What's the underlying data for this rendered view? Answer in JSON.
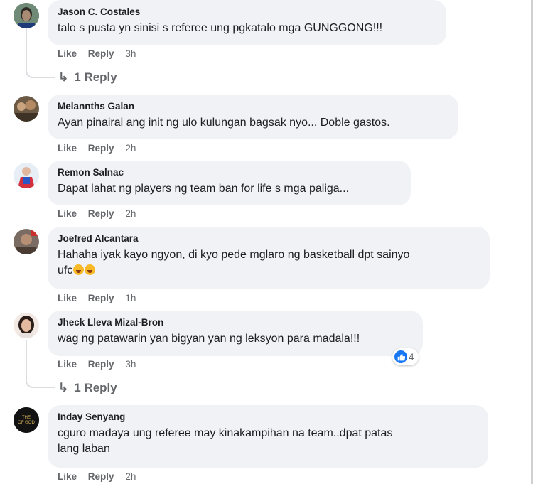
{
  "actions": {
    "like": "Like",
    "reply": "Reply"
  },
  "comments": [
    {
      "author": "Jason C. Costales",
      "text": "talo s pusta yn sinisi s referee ung pgkatalo mga GUNGGONG!!!",
      "time": "3h",
      "replies": "1 Reply"
    },
    {
      "author": "Melannths Galan",
      "text": "Ayan pinairal ang init ng ulo kulungan bagsak nyo... Doble gastos.",
      "time": "2h"
    },
    {
      "author": "Remon Salnac",
      "text": "Dapat lahat ng players ng team ban for life s mga paliga...",
      "time": "2h"
    },
    {
      "author": "Joefred Alcantara",
      "text_line1": "Hahaha iyak kayo ngyon, di kyo pede mglaro ng basketball dpt sainyo",
      "text_line2": "ufc",
      "time": "1h"
    },
    {
      "author": "Jheck Lleva Mizal-Bron",
      "text": "wag ng patawarin yan bigyan yan ng leksyon para madala!!!",
      "time": "3h",
      "reaction_count": "4",
      "replies": "1 Reply"
    },
    {
      "author": "Inday Senyang",
      "text_line1": "cguro madaya ung referee may kinakampihan na team..dpat patas",
      "text_line2": "lang laban",
      "time": "2h"
    }
  ],
  "avatars": {
    "c6_text": "OF GOD"
  },
  "colors": {
    "bubble": "#f0f2f5",
    "muted": "#65676b",
    "like_blue": "#1877f2"
  }
}
